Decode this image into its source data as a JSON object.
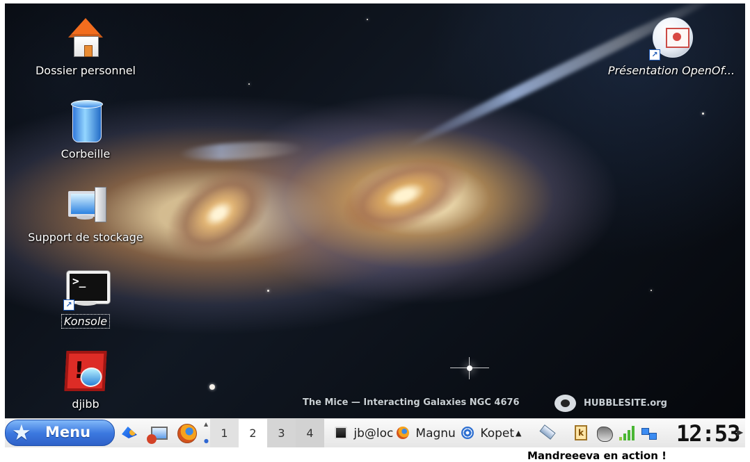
{
  "desktop": {
    "icons": [
      {
        "label": "Dossier personnel",
        "icon": "home-folder-icon"
      },
      {
        "label": "Corbeille",
        "icon": "trash-icon"
      },
      {
        "label": "Support de stockage",
        "icon": "storage-computer-icon"
      },
      {
        "label": "Konsole",
        "icon": "terminal-icon"
      },
      {
        "label": "djibb",
        "icon": "djibb-app-icon"
      },
      {
        "label": "Présentation OpenOf...",
        "icon": "presentation-icon"
      }
    ],
    "wallpaper_credit": "The Mice — Interacting Galaxies NGC 4676",
    "wallpaper_logo": "HUBBLESITE.org"
  },
  "taskbar": {
    "menu_label": "Menu",
    "launchers": [
      {
        "icon": "drawing-launcher-icon"
      },
      {
        "icon": "window-launcher-icon"
      },
      {
        "icon": "firefox-icon"
      }
    ],
    "pager": {
      "desktops": [
        "1",
        "2",
        "3",
        "4"
      ],
      "active_desktop": "2"
    },
    "tasks": [
      {
        "label": "jb@loc",
        "icon": "terminal-task-icon"
      },
      {
        "label": "Magnu",
        "icon": "firefox-task-icon"
      },
      {
        "label": "Kopet",
        "icon": "kopete-task-icon"
      }
    ],
    "tray_icons": [
      "usb-device-icon",
      "klipper-icon",
      "fish-icon",
      "signal-strength-icon",
      "network-icon"
    ],
    "clock": "12:53"
  },
  "caption": "Mandreeeva en action !",
  "colors": {
    "taskbar_menu": "#3b78df",
    "taskbar_background": "#e6e6e6",
    "desktop_background": "#05070b"
  }
}
